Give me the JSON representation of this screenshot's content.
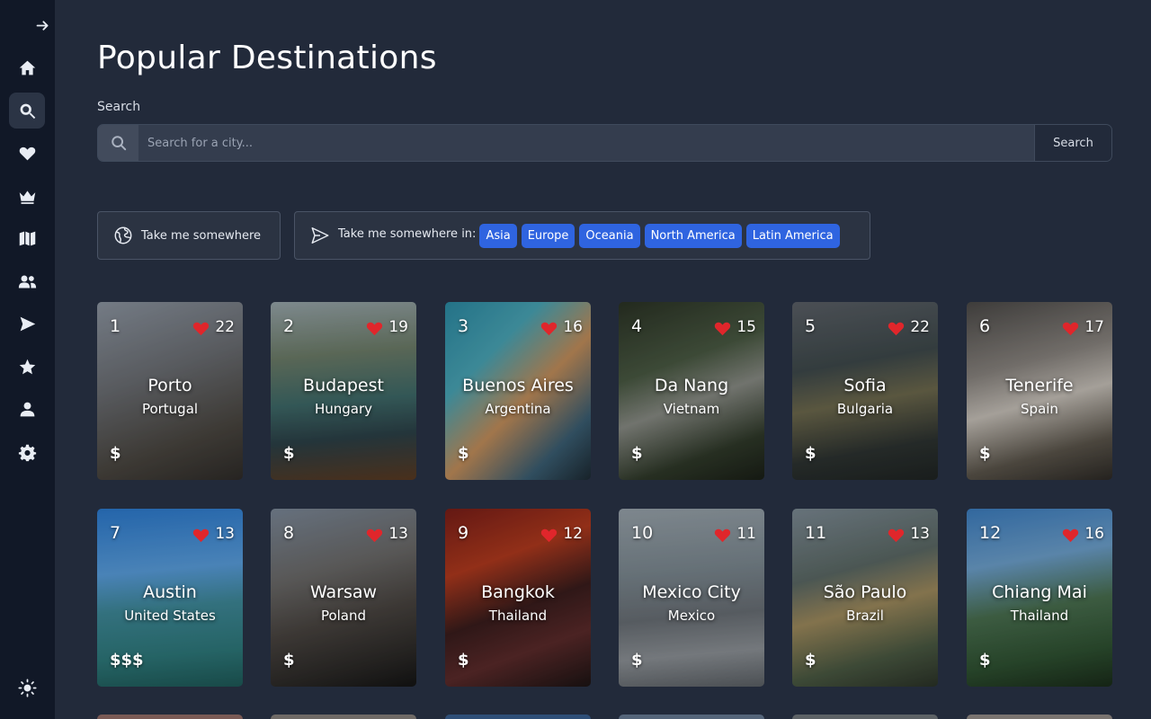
{
  "page": {
    "title": "Popular Destinations"
  },
  "sidebar": {
    "items": [
      {
        "name": "home-icon",
        "active": false
      },
      {
        "name": "search-icon",
        "active": true
      },
      {
        "name": "heart-icon",
        "active": false
      },
      {
        "name": "crown-icon",
        "active": false
      },
      {
        "name": "map-icon",
        "active": false
      },
      {
        "name": "users-icon",
        "active": false
      },
      {
        "name": "send-icon",
        "active": false
      },
      {
        "name": "star-icon",
        "active": false
      },
      {
        "name": "user-icon",
        "active": false
      },
      {
        "name": "gear-icon",
        "active": false
      }
    ],
    "bottom_icon": "sun-icon",
    "top_icon": "arrow-right-icon"
  },
  "search": {
    "label": "Search",
    "placeholder": "Search for a city...",
    "value": "",
    "button_label": "Search"
  },
  "actions": {
    "take_me_label": "Take me somewhere",
    "take_me_in_label": "Take me somewhere in:",
    "regions": [
      "Asia",
      "Europe",
      "Oceania",
      "North America",
      "Latin America"
    ],
    "chip_color": "#2f64e0"
  },
  "cards": [
    {
      "rank": "1",
      "likes": "22",
      "city": "Porto",
      "country": "Portugal",
      "cost": "$"
    },
    {
      "rank": "2",
      "likes": "19",
      "city": "Budapest",
      "country": "Hungary",
      "cost": "$"
    },
    {
      "rank": "3",
      "likes": "16",
      "city": "Buenos Aires",
      "country": "Argentina",
      "cost": "$"
    },
    {
      "rank": "4",
      "likes": "15",
      "city": "Da Nang",
      "country": "Vietnam",
      "cost": "$"
    },
    {
      "rank": "5",
      "likes": "22",
      "city": "Sofia",
      "country": "Bulgaria",
      "cost": "$"
    },
    {
      "rank": "6",
      "likes": "17",
      "city": "Tenerife",
      "country": "Spain",
      "cost": "$"
    },
    {
      "rank": "7",
      "likes": "13",
      "city": "Austin",
      "country": "United States",
      "cost": "$$$"
    },
    {
      "rank": "8",
      "likes": "13",
      "city": "Warsaw",
      "country": "Poland",
      "cost": "$"
    },
    {
      "rank": "9",
      "likes": "12",
      "city": "Bangkok",
      "country": "Thailand",
      "cost": "$"
    },
    {
      "rank": "10",
      "likes": "11",
      "city": "Mexico City",
      "country": "Mexico",
      "cost": "$"
    },
    {
      "rank": "11",
      "likes": "13",
      "city": "São Paulo",
      "country": "Brazil",
      "cost": "$"
    },
    {
      "rank": "12",
      "likes": "16",
      "city": "Chiang Mai",
      "country": "Thailand",
      "cost": "$"
    }
  ],
  "colors": {
    "heart": "#e0262b",
    "background": "#222a3a",
    "sidebar": "#111827"
  }
}
